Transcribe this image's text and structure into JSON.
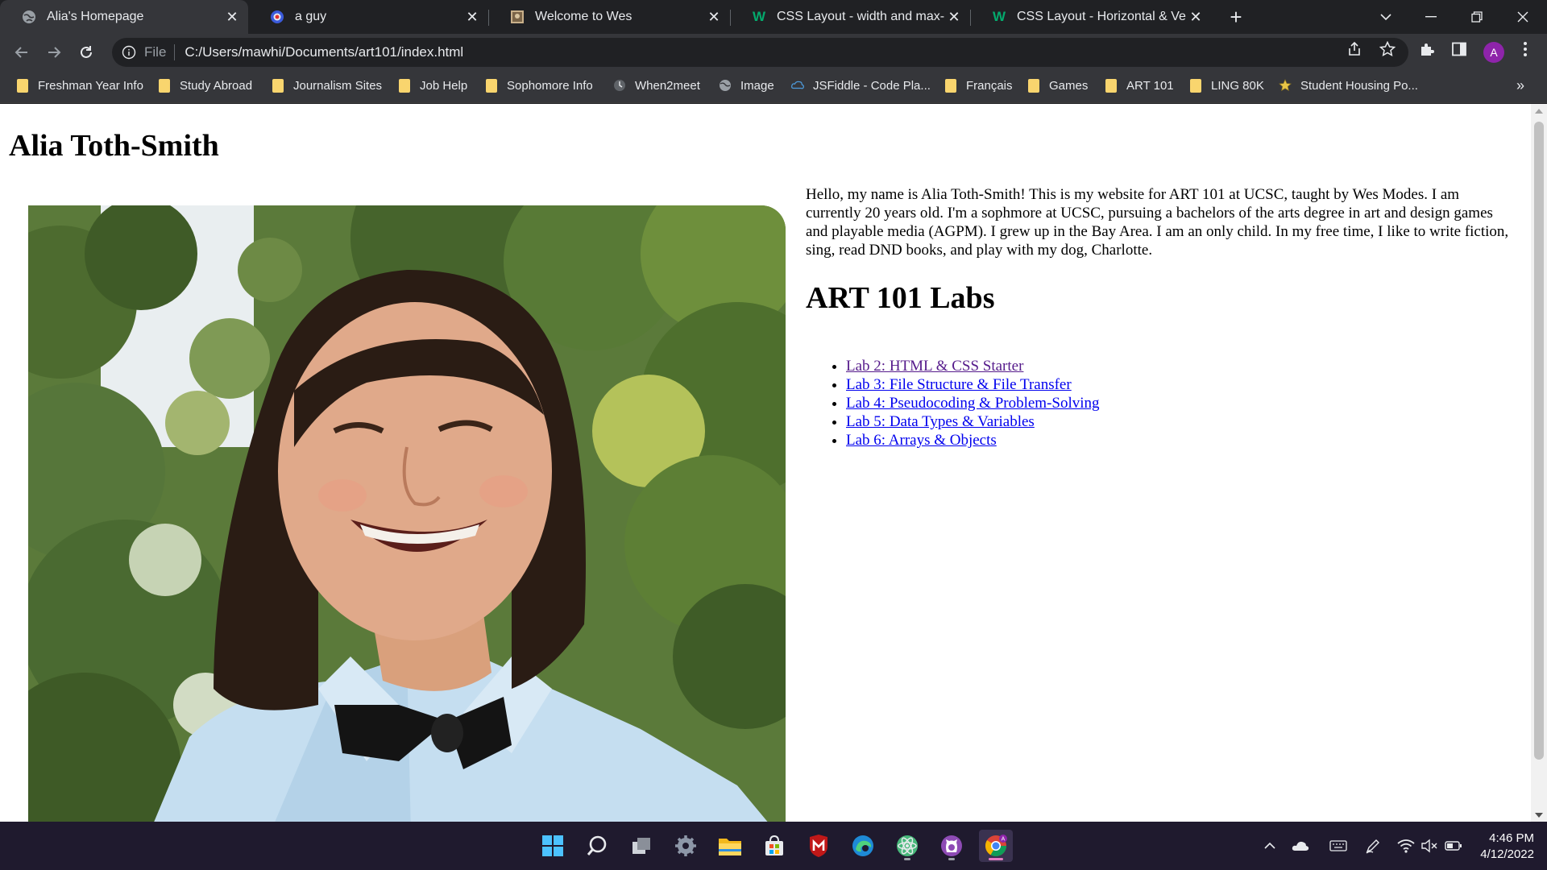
{
  "browser": {
    "tabs": [
      {
        "title": "Alia's Homepage",
        "favicon": "globe-icon",
        "active": true
      },
      {
        "title": "a guy",
        "favicon": "app-icon",
        "active": false
      },
      {
        "title": "Welcome to Wes",
        "favicon": "image-icon",
        "active": false
      },
      {
        "title": "CSS Layout - width and max-widt",
        "favicon": "w3schools-icon",
        "active": false
      },
      {
        "title": "CSS Layout - Horizontal & Vertica",
        "favicon": "w3schools-icon",
        "active": false
      }
    ],
    "address": {
      "scheme_label": "File",
      "url": "C:/Users/mawhi/Documents/art101/index.html"
    },
    "profile_initial": "A",
    "bookmarks": [
      {
        "label": "Freshman Year Info",
        "icon": "folder-icon"
      },
      {
        "label": "Study Abroad",
        "icon": "folder-icon"
      },
      {
        "label": "Journalism Sites",
        "icon": "folder-icon"
      },
      {
        "label": "Job Help",
        "icon": "folder-icon"
      },
      {
        "label": "Sophomore Info",
        "icon": "folder-icon"
      },
      {
        "label": "When2meet",
        "icon": "when2meet-icon"
      },
      {
        "label": "Image",
        "icon": "globe-icon"
      },
      {
        "label": "JSFiddle - Code Pla...",
        "icon": "jsfiddle-icon"
      },
      {
        "label": "Français",
        "icon": "folder-icon"
      },
      {
        "label": "Games",
        "icon": "folder-icon"
      },
      {
        "label": "ART 101",
        "icon": "folder-icon"
      },
      {
        "label": "LING 80K",
        "icon": "folder-icon"
      },
      {
        "label": "Student Housing Po...",
        "icon": "star-icon"
      }
    ],
    "bookmarks_more": "»"
  },
  "page": {
    "title": "Alia Toth-Smith",
    "photo_alt": "portrait-photo",
    "bio": "Hello, my name is Alia Toth-Smith! This is my website for ART 101 at UCSC, taught by Wes Modes. I am currently 20 years old. I'm a sophmore at UCSC, pursuing a bachelors of the arts degree in art and design games and playable media (AGPM). I grew up in the Bay Area. I am an only child. In my free time, I like to write fiction, sing, read DND books, and play with my dog, Charlotte.",
    "labs_heading": "ART 101 Labs",
    "labs": [
      {
        "label": "Lab 2: HTML & CSS Starter",
        "visited": true
      },
      {
        "label": "Lab 3: File Structure & File Transfer",
        "visited": false
      },
      {
        "label": "Lab 4: Pseudocoding & Problem-Solving",
        "visited": false
      },
      {
        "label": "Lab 5: Data Types & Variables",
        "visited": false
      },
      {
        "label": "Lab 6: Arrays & Objects",
        "visited": false
      }
    ],
    "colors": {
      "visited_link": "#551a8b",
      "link": "#0000ee"
    }
  },
  "taskbar": {
    "apps": [
      "start-icon",
      "search-icon",
      "task-view-icon",
      "settings-icon",
      "file-explorer-icon",
      "store-icon",
      "mcafee-icon",
      "edge-icon",
      "atom-icon",
      "github-desktop-icon",
      "chrome-icon"
    ],
    "time": "4:46 PM",
    "date": "4/12/2022"
  }
}
